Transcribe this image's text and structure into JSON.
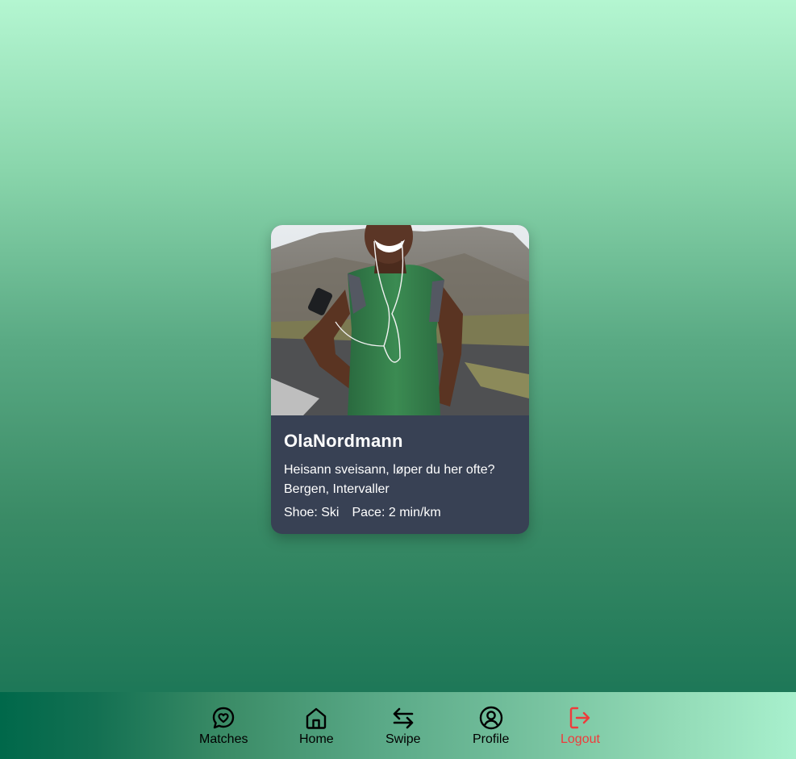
{
  "profile": {
    "name": "OlaNordmann",
    "bio": "Heisann sveisann, løper du her ofte?",
    "meta": "Bergen, Intervaller",
    "shoe": "Shoe: Ski",
    "pace": "Pace: 2 min/km"
  },
  "nav": {
    "matches": "Matches",
    "home": "Home",
    "swipe": "Swipe",
    "profile": "Profile",
    "logout": "Logout"
  },
  "colors": {
    "card_bg": "#384154",
    "logout": "#ef3b3b"
  }
}
